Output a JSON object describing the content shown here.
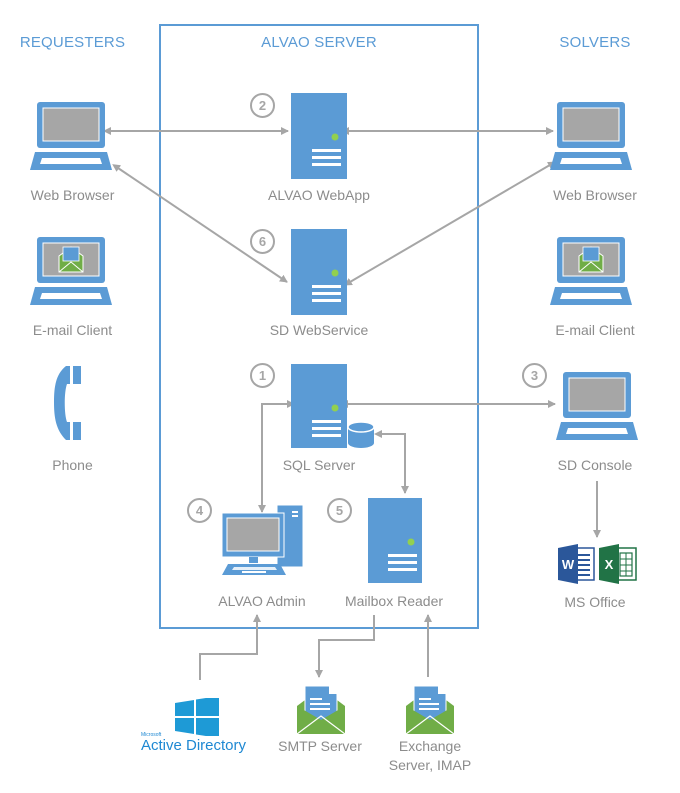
{
  "sections": {
    "requesters": "REQUESTERS",
    "server": "ALVAO SERVER",
    "solvers": "SOLVERS"
  },
  "requesters": [
    {
      "label": "Web Browser",
      "icon": "laptop-icon"
    },
    {
      "label": "E-mail Client",
      "icon": "laptop-email-icon"
    },
    {
      "label": "Phone",
      "icon": "phone-icon"
    }
  ],
  "server_components": [
    {
      "number": "2",
      "label": "ALVAO WebApp",
      "icon": "server-icon"
    },
    {
      "number": "6",
      "label": "SD WebService",
      "icon": "server-icon"
    },
    {
      "number": "1",
      "label": "SQL Server",
      "icon": "server-database-icon"
    },
    {
      "number": "4",
      "label": "ALVAO Admin",
      "icon": "desktop-pc-icon"
    },
    {
      "number": "5",
      "label": "Mailbox Reader",
      "icon": "server-icon"
    }
  ],
  "solvers": [
    {
      "label": "Web Browser",
      "icon": "laptop-icon"
    },
    {
      "label": "E-mail Client",
      "icon": "laptop-email-icon"
    },
    {
      "number": "3",
      "label": "SD Console",
      "icon": "laptop-icon"
    },
    {
      "label": "MS Office",
      "icon": "word-excel-icon"
    }
  ],
  "external": [
    {
      "label": "Active Directory",
      "brand_prefix": "Microsoft",
      "icon": "windows-logo-icon"
    },
    {
      "label": "SMTP Server",
      "icon": "email-envelope-icon"
    },
    {
      "label_line1": "Exchange",
      "label_line2": "Server, IMAP",
      "icon": "email-envelope-icon"
    }
  ],
  "office_letters": {
    "word": "W",
    "excel": "X"
  },
  "colors": {
    "accent_blue": "#5b9bd5",
    "screen_gray": "#a6a6a6",
    "arrow_gray": "#a6a6a6",
    "label_gray": "#8c8c8c",
    "led_green": "#92d050",
    "envelope_green": "#70ad47",
    "word_blue": "#2b579a",
    "excel_green": "#217346",
    "ad_blue": "#1e88d2"
  }
}
